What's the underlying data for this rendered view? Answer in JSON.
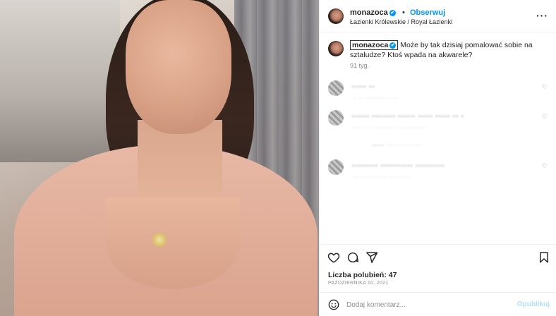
{
  "post": {
    "username": "monazoca",
    "verified_mark": "✔",
    "dot": "•",
    "follow_label": "Obserwuj",
    "location": "Łazienki Królewskie / Royal Łazienki",
    "more_icon": "more-icon",
    "caption_user": "monazoca",
    "caption_text": "Może by tak dzisiaj pomalować sobie na sztaludze? Ktoś wpada na akwarele?",
    "caption_time": "91 tyg."
  },
  "comments": [
    {
      "line": "·····  ··",
      "meta": "·· ··  ·········  ···",
      "heart": "♡"
    },
    {
      "line": "······ ········ ······ ····· ····· ·· ·",
      "meta": "··· ···· ··········  ···········",
      "heart": "♡"
    },
    {
      "line": "·········  ···········  ··········",
      "meta": "··· ··········  ·········",
      "heart": "♡"
    }
  ],
  "reply_link": "——  ········  ·····",
  "actions": {
    "like_icon": "heart-icon",
    "comment_icon": "comment-icon",
    "share_icon": "share-icon",
    "save_icon": "bookmark-icon"
  },
  "likes_text": "Liczba polubień: 47",
  "date_text": "PAŹDZIERNIKA 10, 2021",
  "add_comment": {
    "placeholder": "Dodaj komentarz...",
    "post_label": "Opublikuj"
  }
}
